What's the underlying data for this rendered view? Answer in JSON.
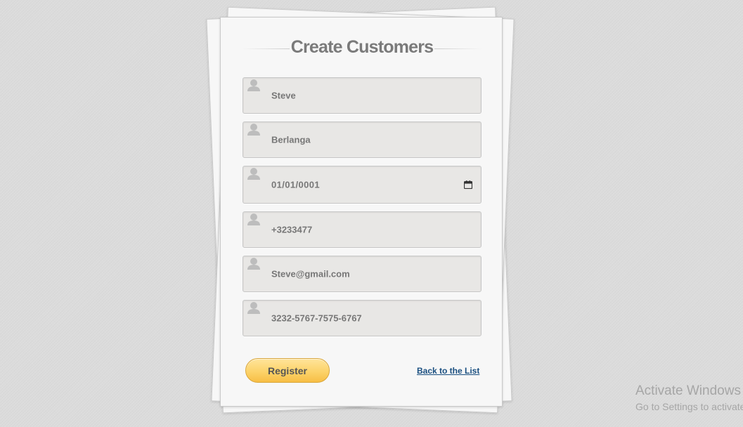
{
  "form": {
    "title": "Create Customers",
    "fields": [
      {
        "name": "first-name",
        "value": "Steve"
      },
      {
        "name": "last-name",
        "value": "Berlanga"
      },
      {
        "name": "birth-date",
        "value": "01/01/0001"
      },
      {
        "name": "phone",
        "value": "+3233477"
      },
      {
        "name": "email",
        "value": "Steve@gmail.com"
      },
      {
        "name": "card-number",
        "value": "3232-5767-7575-6767"
      }
    ],
    "register_label": "Register",
    "back_link_label": "Back to the List"
  },
  "watermark": {
    "line1": "Activate Windows",
    "line2": "Go to Settings to activate Windows."
  },
  "colors": {
    "accent_button": "#fcd36a",
    "link": "#1a4f80",
    "field_bg": "#e8e7e5"
  },
  "icons": {
    "field_icon": "user-icon",
    "date_picker_icon": "calendar-icon"
  }
}
